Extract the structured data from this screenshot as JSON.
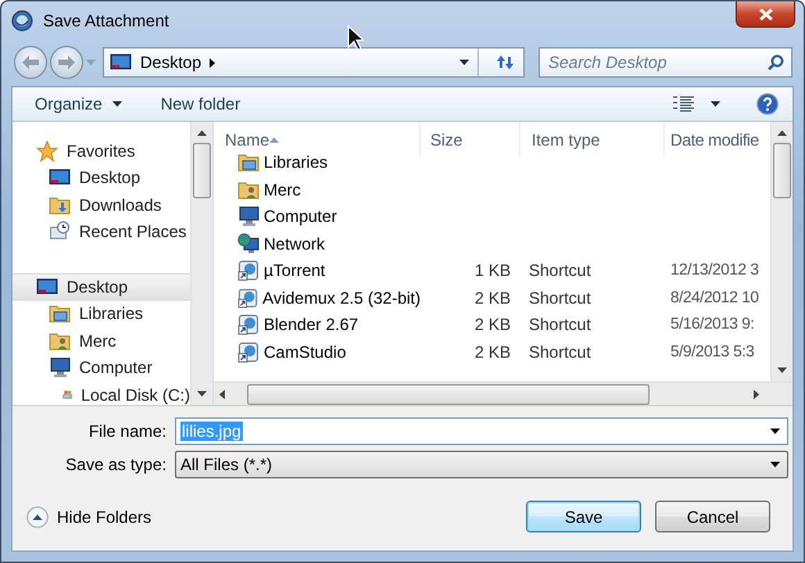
{
  "window": {
    "title": "Save Attachment"
  },
  "address": {
    "location": "Desktop"
  },
  "search": {
    "placeholder": "Search Desktop"
  },
  "toolbar": {
    "items": [
      {
        "label": "Organize",
        "kind": "menu"
      },
      {
        "label": "New folder",
        "kind": "button"
      }
    ]
  },
  "nav": {
    "items": [
      {
        "label": "Favorites",
        "kind": "star",
        "selected": false,
        "children": [
          {
            "label": "Desktop",
            "kind": "desktop",
            "selected": false
          },
          {
            "label": "Downloads",
            "kind": "downloads",
            "selected": false
          },
          {
            "label": "Recent Places",
            "kind": "recent",
            "selected": false
          }
        ]
      },
      {
        "label": "Desktop",
        "kind": "desktop",
        "selected": true,
        "children": [
          {
            "label": "Libraries",
            "kind": "library",
            "selected": false
          },
          {
            "label": "Merc",
            "kind": "user",
            "selected": false
          },
          {
            "label": "Computer",
            "kind": "computer",
            "selected": false,
            "children": [
              {
                "label": "Local Disk (C:)",
                "kind": "disk",
                "selected": false
              }
            ]
          }
        ]
      }
    ]
  },
  "files": {
    "columns": [
      "Name",
      "Size",
      "Item type",
      "Date modifie"
    ],
    "rows": [
      {
        "name": "Libraries",
        "kind": "library"
      },
      {
        "name": "Merc",
        "kind": "user"
      },
      {
        "name": "Computer",
        "kind": "computer"
      },
      {
        "name": "Network",
        "kind": "network"
      },
      {
        "name": "µTorrent",
        "kind": "shortcut",
        "size": "1 KB",
        "type": "Shortcut",
        "date": "12/13/2012 3"
      },
      {
        "name": "Avidemux 2.5 (32-bit)",
        "kind": "shortcut",
        "size": "2 KB",
        "type": "Shortcut",
        "date": "8/24/2012 10"
      },
      {
        "name": "Blender 2.67",
        "kind": "shortcut",
        "size": "2 KB",
        "type": "Shortcut",
        "date": "5/16/2013 9:"
      },
      {
        "name": "CamStudio",
        "kind": "shortcut",
        "size": "2 KB",
        "type": "Shortcut",
        "date": "5/9/2013 5:3"
      }
    ]
  },
  "file_name": {
    "label": "File name:",
    "value": "lilies.jpg",
    "selected": true
  },
  "save_type": {
    "label": "Save as type:",
    "value": "All Files (*.*)"
  },
  "hide_folders": "Hide Folders",
  "buttons": [
    {
      "label": "Save",
      "default": true
    },
    {
      "label": "Cancel",
      "default": false
    }
  ]
}
